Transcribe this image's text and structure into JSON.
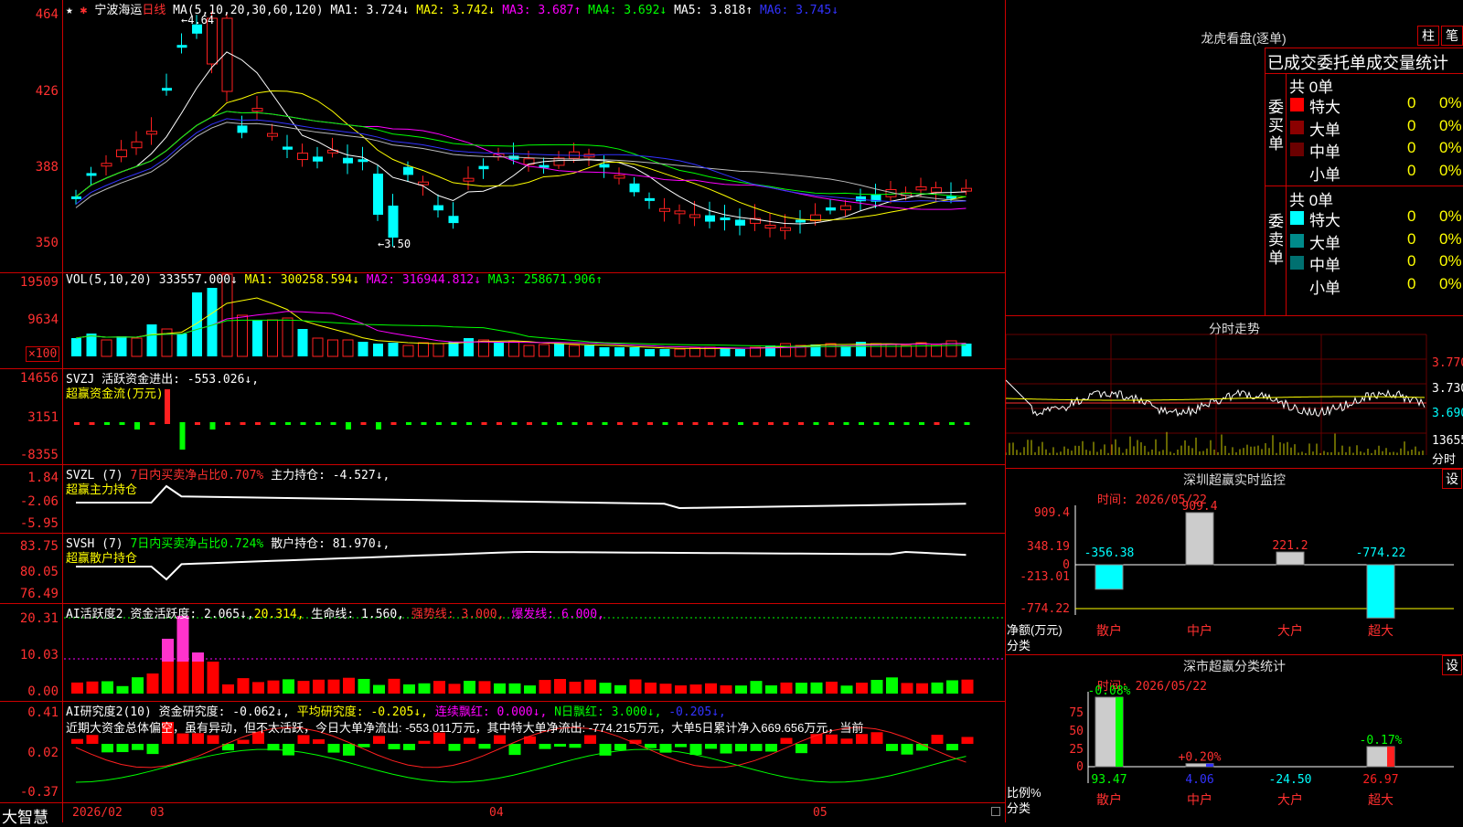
{
  "brand": "大智慧",
  "main_chart": {
    "title_icon": "star-icon",
    "stock_name": "宁波海运",
    "period": "日线",
    "ma_label": "MA(5,10,20,30,60,120)",
    "ma1": "MA1: 3.724↓",
    "ma2": "MA2: 3.742↓",
    "ma3": "MA3: 3.687↑",
    "ma4": "MA4: 3.692↓",
    "ma5": "MA5: 3.818↑",
    "ma6": "MA6: 3.745↓",
    "high_annot": "←4.64",
    "low_annot": "←3.50",
    "y_ticks": [
      "464",
      "426",
      "388",
      "350"
    ]
  },
  "vol": {
    "label": "VOL(5,10,20)",
    "value": "333557.000↓",
    "ma1": "MA1: 300258.594↓",
    "ma2": "MA2: 316944.812↓",
    "ma3": "MA3: 258671.906↑",
    "y_ticks": [
      "19509",
      "9634"
    ],
    "unit_badge": "×100"
  },
  "svzj": {
    "label": "SVZJ",
    "desc": "活跃资金进出: -553.026↓,",
    "sub": "超赢资金流(万元)",
    "y_ticks": [
      "14656",
      "3151",
      "-8355"
    ]
  },
  "svzl": {
    "label": "SVZL (7)",
    "pct": "7日内买卖净占比0.707%",
    "pos": "主力持仓: -4.527↓,",
    "sub": "超赢主力持仓",
    "y_ticks": [
      "1.84",
      "-2.06",
      "-5.95"
    ]
  },
  "svsh": {
    "label": "SVSH (7)",
    "pct": "7日内买卖净占比0.724%",
    "pos": "散户持仓: 81.970↓,",
    "sub": "超赢散户持仓",
    "y_ticks": [
      "83.75",
      "80.05",
      "76.49"
    ]
  },
  "ai_active": {
    "label": "AI活跃度2",
    "active": "资金活跃度: 2.065↓,",
    "v2": "20.314,",
    "life": "生命线: 1.560,",
    "strong": "强势线: 3.000,",
    "burst": "爆发线: 6.000,",
    "y_ticks": [
      "20.31",
      "10.03",
      "0.00"
    ]
  },
  "ai_research": {
    "label": "AI研究度2(10)",
    "research": "资金研究度: -0.062↓,",
    "avg": "平均研究度: -0.205↓,",
    "streak": "连续飘红: 0.000↓,",
    "nday": "N日飘红: 3.000↓,",
    "last": "-0.205↓,",
    "comment": "近期大资金总体偏空，虽有异动，但不太活跃，今日大单净流出: -553.011万元，其中特大单净流出: -774.215万元，大单5日累计净入669.656万元，当前",
    "y_ticks": [
      "0.41",
      "0.02",
      "-0.37"
    ]
  },
  "x_axis": [
    "2026/02",
    "03",
    "04",
    "05"
  ],
  "right": {
    "dragon_title": "龙虎看盘(逐单)",
    "btn_bar": "柱",
    "btn_pen": "笔",
    "stats_title": "已成交委托单成交量统计",
    "buy_label": "委买单",
    "sell_label": "委卖单",
    "buy_total": "共 0单",
    "sell_total": "共 0单",
    "buy_rows": [
      {
        "name": "特大",
        "count": "0",
        "pct": "0%",
        "color": "#ff0000"
      },
      {
        "name": "大单",
        "count": "0",
        "pct": "0%",
        "color": "#8b0000"
      },
      {
        "name": "中单",
        "count": "0",
        "pct": "0%",
        "color": "#6b0000"
      },
      {
        "name": "小单",
        "count": "0",
        "pct": "0%",
        "color": "#000000"
      }
    ],
    "sell_rows": [
      {
        "name": "特大",
        "count": "0",
        "pct": "0%",
        "color": "#00ffff"
      },
      {
        "name": "大单",
        "count": "0",
        "pct": "0%",
        "color": "#008b8b"
      },
      {
        "name": "中单",
        "count": "0",
        "pct": "0%",
        "color": "#007070"
      },
      {
        "name": "小单",
        "count": "0",
        "pct": "0%",
        "color": "#000000"
      }
    ],
    "intraday_title": "分时走势",
    "intraday_prices": [
      "3.770",
      "3.730",
      "3.690"
    ],
    "intraday_vol": "13655",
    "intraday_label": "分时",
    "sz_monitor_title": "深圳超赢实时监控",
    "sz_set": "设",
    "sz_time": "时间: 2026/05/22",
    "sz_y": [
      "909.4",
      "348.19",
      "0",
      "-213.01",
      "-774.22"
    ],
    "sz_bars": [
      {
        "cat": "散户",
        "value": "-356.38"
      },
      {
        "cat": "中户",
        "value": "909.4"
      },
      {
        "cat": "大户",
        "value": "221.2"
      },
      {
        "cat": "超大",
        "value": "-774.22"
      }
    ],
    "sz_axis_label1": "净额(万元)",
    "sz_axis_label2": "分类",
    "sc_title": "深市超赢分类统计",
    "sc_set": "设",
    "sc_time": "时间: 2026/05/22",
    "sc_y": [
      "75",
      "50",
      "25",
      "0"
    ],
    "sc_bars": [
      {
        "cat": "散户",
        "value": "93.47",
        "delta": "-0.08%"
      },
      {
        "cat": "中户",
        "value": "4.06",
        "delta": "+0.20%"
      },
      {
        "cat": "大户",
        "value": "-24.50",
        "delta": ""
      },
      {
        "cat": "超大",
        "value": "26.97",
        "delta": "-0.17%"
      }
    ],
    "sc_axis_label1": "比例%",
    "sc_axis_label2": "分类"
  }
}
